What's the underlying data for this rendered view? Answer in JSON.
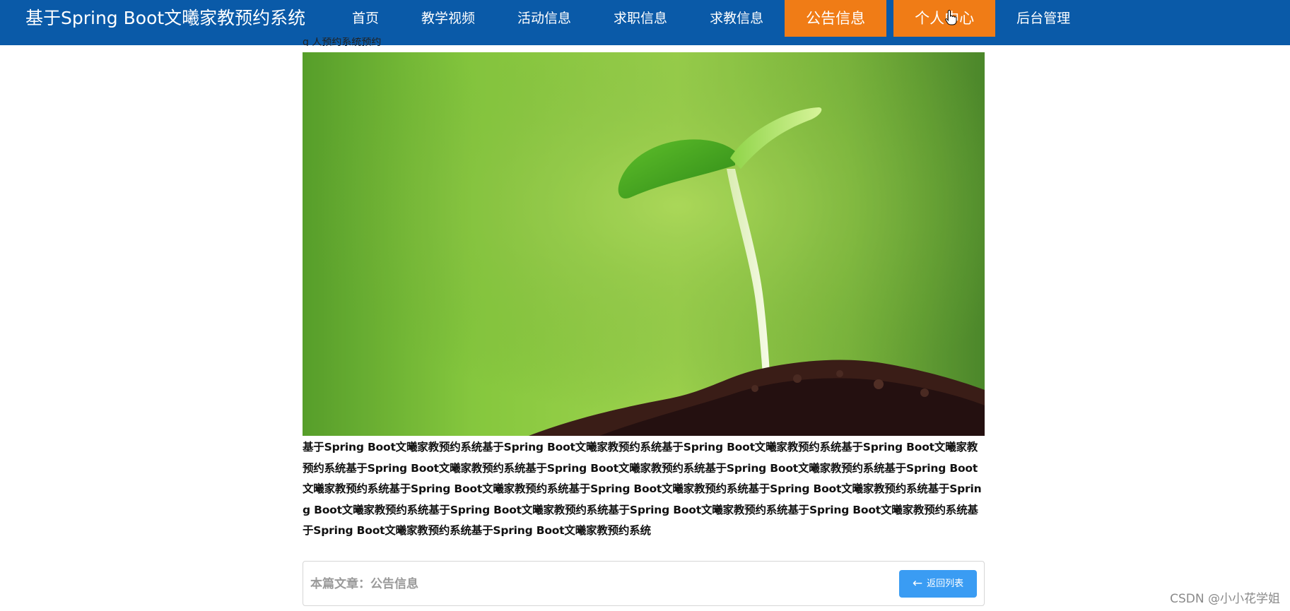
{
  "header": {
    "brand": "基于Spring Boot文曦家教预约系统",
    "nav": [
      {
        "label": "首页",
        "active": false
      },
      {
        "label": "教学视频",
        "active": false
      },
      {
        "label": "活动信息",
        "active": false
      },
      {
        "label": "求职信息",
        "active": false
      },
      {
        "label": "求教信息",
        "active": false
      },
      {
        "label": "公告信息",
        "active": true
      },
      {
        "label": "个人中心",
        "active": true
      },
      {
        "label": "后台管理",
        "active": false
      }
    ],
    "colors": {
      "bar": "#0a5aa8",
      "active": "#f07c16"
    }
  },
  "article": {
    "clipped_title": "g      人预约系统预约",
    "image_icon": "seedling-sprout-image",
    "body": "基于Spring Boot文曦家教预约系统基于Spring Boot文曦家教预约系统基于Spring Boot文曦家教预约系统基于Spring Boot文曦家教预约系统基于Spring Boot文曦家教预约系统基于Spring Boot文曦家教预约系统基于Spring Boot文曦家教预约系统基于Spring Boot文曦家教预约系统基于Spring Boot文曦家教预约系统基于Spring Boot文曦家教预约系统基于Spring Boot文曦家教预约系统基于Spring Boot文曦家教预约系统基于Spring Boot文曦家教预约系统基于Spring Boot文曦家教预约系统基于Spring Boot文曦家教预约系统基于Spring Boot文曦家教预约系统基于Spring Boot文曦家教预约系统"
  },
  "footer": {
    "article_label": "本篇文章：公告信息",
    "back_button": "返回列表",
    "back_icon": "arrow-left-icon",
    "button_color": "#3a9cf3"
  },
  "watermark": "CSDN @小小花学姐"
}
